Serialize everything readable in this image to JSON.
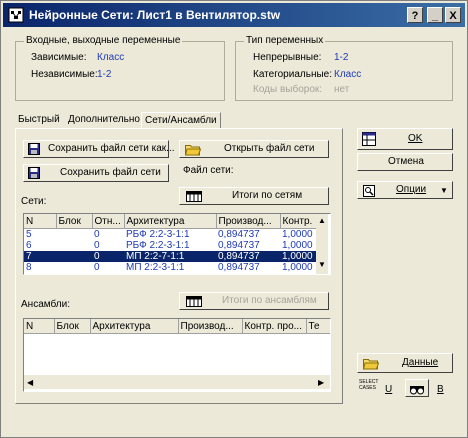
{
  "window": {
    "title": "Нейронные Сети: Лист1 в Вентилятор.stw",
    "help_label": "?",
    "minimize_label": "_",
    "close_label": "X"
  },
  "inout_group": {
    "title": "Входные, выходные переменные",
    "dependent_label": "Зависимые:",
    "dependent_value": "Класс",
    "independent_label": "Независимые:",
    "independent_value": "1-2"
  },
  "types_group": {
    "title": "Тип переменных",
    "continuous_label": "Непрерывные:",
    "continuous_value": "1-2",
    "categorical_label": "Категориальные:",
    "categorical_value": "Класс",
    "cases_label": "Коды выборок:",
    "cases_value": "нет"
  },
  "tabs": [
    {
      "label": "Быстрый"
    },
    {
      "label": "Дополнительно"
    },
    {
      "label": "Сети/Ансамбли"
    }
  ],
  "buttons": {
    "save_as": "Сохранить файл сети как...",
    "save": "Сохранить файл сети",
    "open": "Открыть файл сети",
    "file_label": "Файл сети:",
    "net_totals": "Итоги по сетям",
    "ens_totals": "Итоги по ансамблям",
    "ok": "OK",
    "cancel": "Отмена",
    "options": "Опции",
    "data": "Данные",
    "select_cases": "SELECT CASES",
    "u_label": "U",
    "b_label": "B"
  },
  "networks": {
    "label": "Сети:",
    "columns": [
      "N",
      "Блок",
      "Отн...",
      "Архитектура",
      "Производ...",
      "Контр."
    ],
    "rows": [
      [
        "5",
        "",
        "0",
        "РБФ 2:2-3-1:1",
        "0,894737",
        "1,0000"
      ],
      [
        "6",
        "",
        "0",
        "РБФ 2:2-3-1:1",
        "0,894737",
        "1,0000"
      ],
      [
        "7",
        "",
        "0",
        "МП 2:2-7-1:1",
        "0,894737",
        "1,0000"
      ],
      [
        "8",
        "",
        "0",
        "МП 2:2-3-1:1",
        "0,894737",
        "1,0000"
      ]
    ],
    "selected_row": 2
  },
  "ensembles": {
    "label": "Ансамбли:",
    "columns": [
      "N",
      "Блок",
      "Архитектура",
      "Производ...",
      "Контр. про...",
      "Те"
    ]
  },
  "colors": {
    "titlebar": "#0a246a",
    "value_text": "#1f3bb5",
    "selection": "#0a246a",
    "face": "#ece9d8"
  }
}
